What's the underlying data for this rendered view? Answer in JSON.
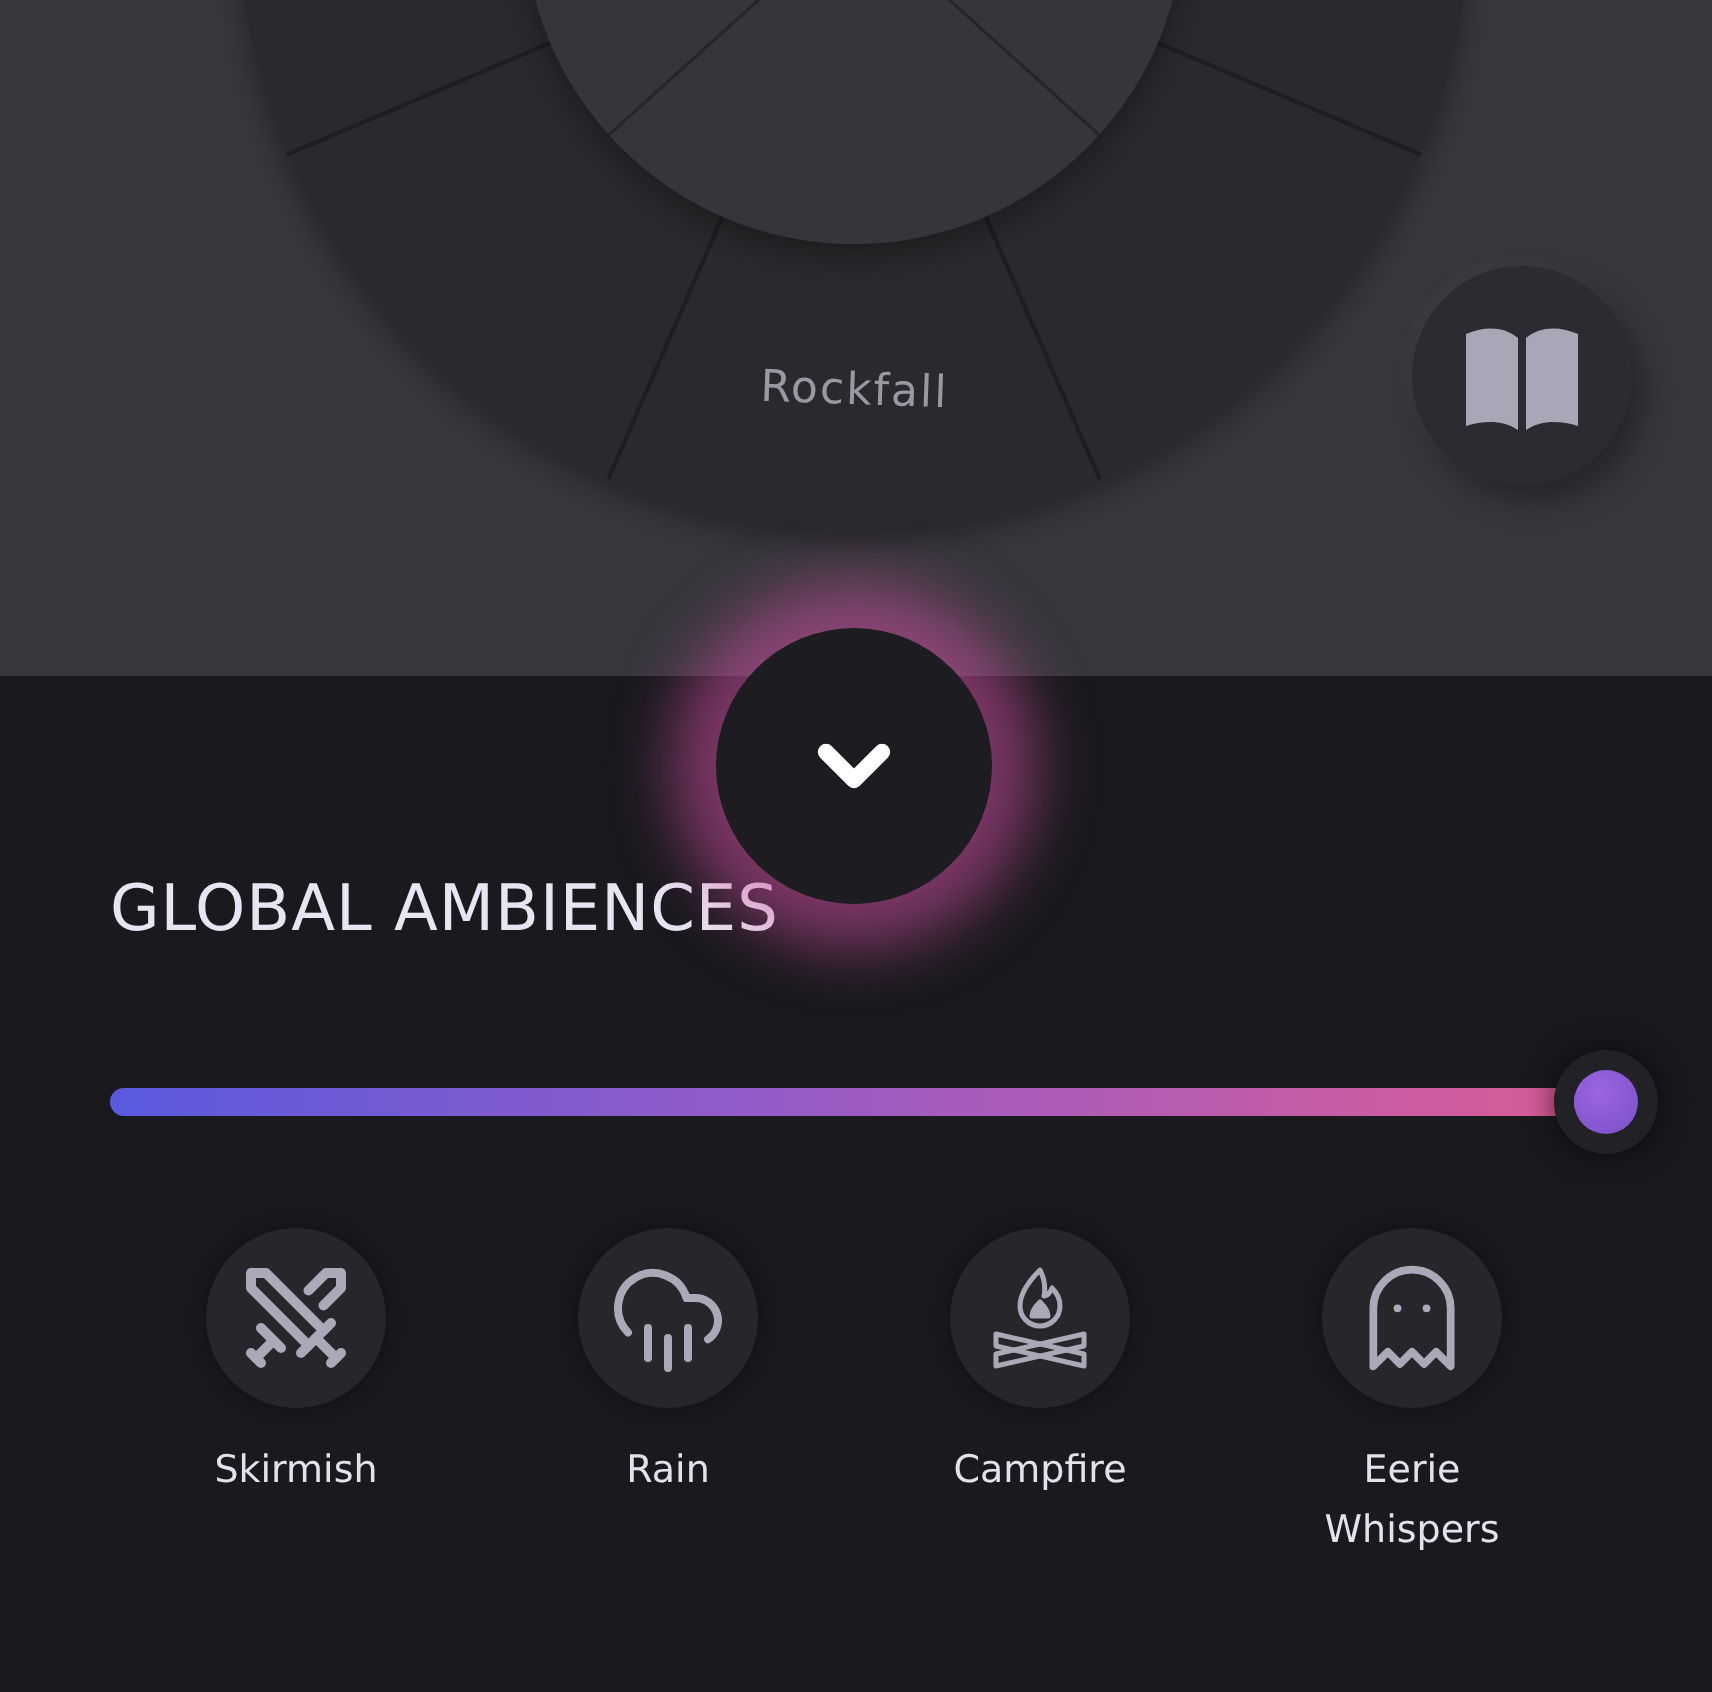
{
  "wheel": {
    "segment_label": "Rockfall"
  },
  "section": {
    "title": "GLOBAL AMBIENCES"
  },
  "volume": {
    "level": 1
  },
  "ambiences": [
    {
      "label": "Skirmish",
      "kind": "swords"
    },
    {
      "label": "Rain",
      "kind": "rain"
    },
    {
      "label": "Campfire",
      "kind": "campfire"
    },
    {
      "label": "Eerie Whispers",
      "kind": "ghost"
    }
  ]
}
